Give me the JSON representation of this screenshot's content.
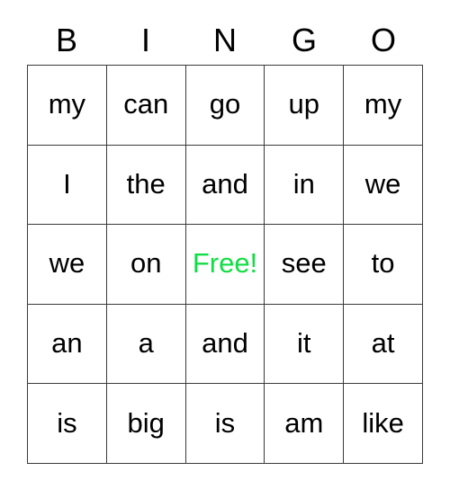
{
  "card": {
    "title_letters": [
      "B",
      "I",
      "N",
      "G",
      "O"
    ],
    "free_color": "#11dd44",
    "text_color": "#000000",
    "border_color": "#3a3a3a",
    "background_color": "#ffffff",
    "rows": [
      {
        "cells": [
          {
            "text": "my",
            "free": false
          },
          {
            "text": "can",
            "free": false
          },
          {
            "text": "go",
            "free": false
          },
          {
            "text": "up",
            "free": false
          },
          {
            "text": "my",
            "free": false
          }
        ]
      },
      {
        "cells": [
          {
            "text": "I",
            "free": false
          },
          {
            "text": "the",
            "free": false
          },
          {
            "text": "and",
            "free": false
          },
          {
            "text": "in",
            "free": false
          },
          {
            "text": "we",
            "free": false
          }
        ]
      },
      {
        "cells": [
          {
            "text": "we",
            "free": false
          },
          {
            "text": "on",
            "free": false
          },
          {
            "text": "Free!",
            "free": true
          },
          {
            "text": "see",
            "free": false
          },
          {
            "text": "to",
            "free": false
          }
        ]
      },
      {
        "cells": [
          {
            "text": "an",
            "free": false
          },
          {
            "text": "a",
            "free": false
          },
          {
            "text": "and",
            "free": false
          },
          {
            "text": "it",
            "free": false
          },
          {
            "text": "at",
            "free": false
          }
        ]
      },
      {
        "cells": [
          {
            "text": "is",
            "free": false
          },
          {
            "text": "big",
            "free": false
          },
          {
            "text": "is",
            "free": false
          },
          {
            "text": "am",
            "free": false
          },
          {
            "text": "like",
            "free": false
          }
        ]
      }
    ]
  }
}
